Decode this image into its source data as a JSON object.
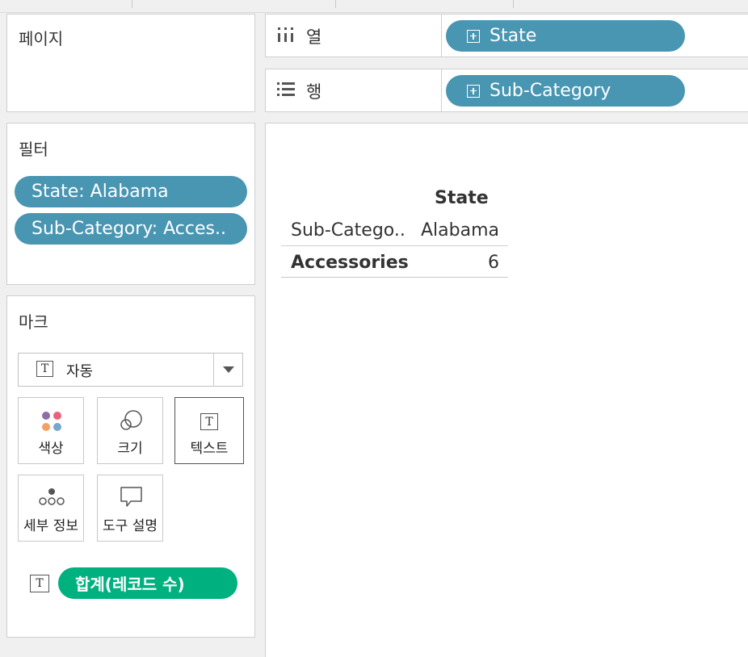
{
  "pages_shelf": {
    "title": "페이지"
  },
  "columns_shelf": {
    "label": "열",
    "pill": "State"
  },
  "rows_shelf": {
    "label": "행",
    "pill": "Sub-Category"
  },
  "filters": {
    "title": "필터",
    "items": [
      "State: Alabama",
      "Sub-Category: Acces.."
    ]
  },
  "marks": {
    "title": "마크",
    "mark_type": "자동",
    "cards": {
      "color": "색상",
      "size": "크기",
      "text": "텍스트",
      "detail": "세부 정보",
      "tooltip": "도구 설명"
    },
    "field_pill": "합계(레코드 수)",
    "colors": {
      "pill_blue": "#4996b2",
      "pill_green": "#00b180"
    }
  },
  "view": {
    "column_header_title": "State",
    "row_header_title": "Sub-Catego..",
    "column_value": "Alabama",
    "row_value": "Accessories",
    "cell_value": "6"
  }
}
